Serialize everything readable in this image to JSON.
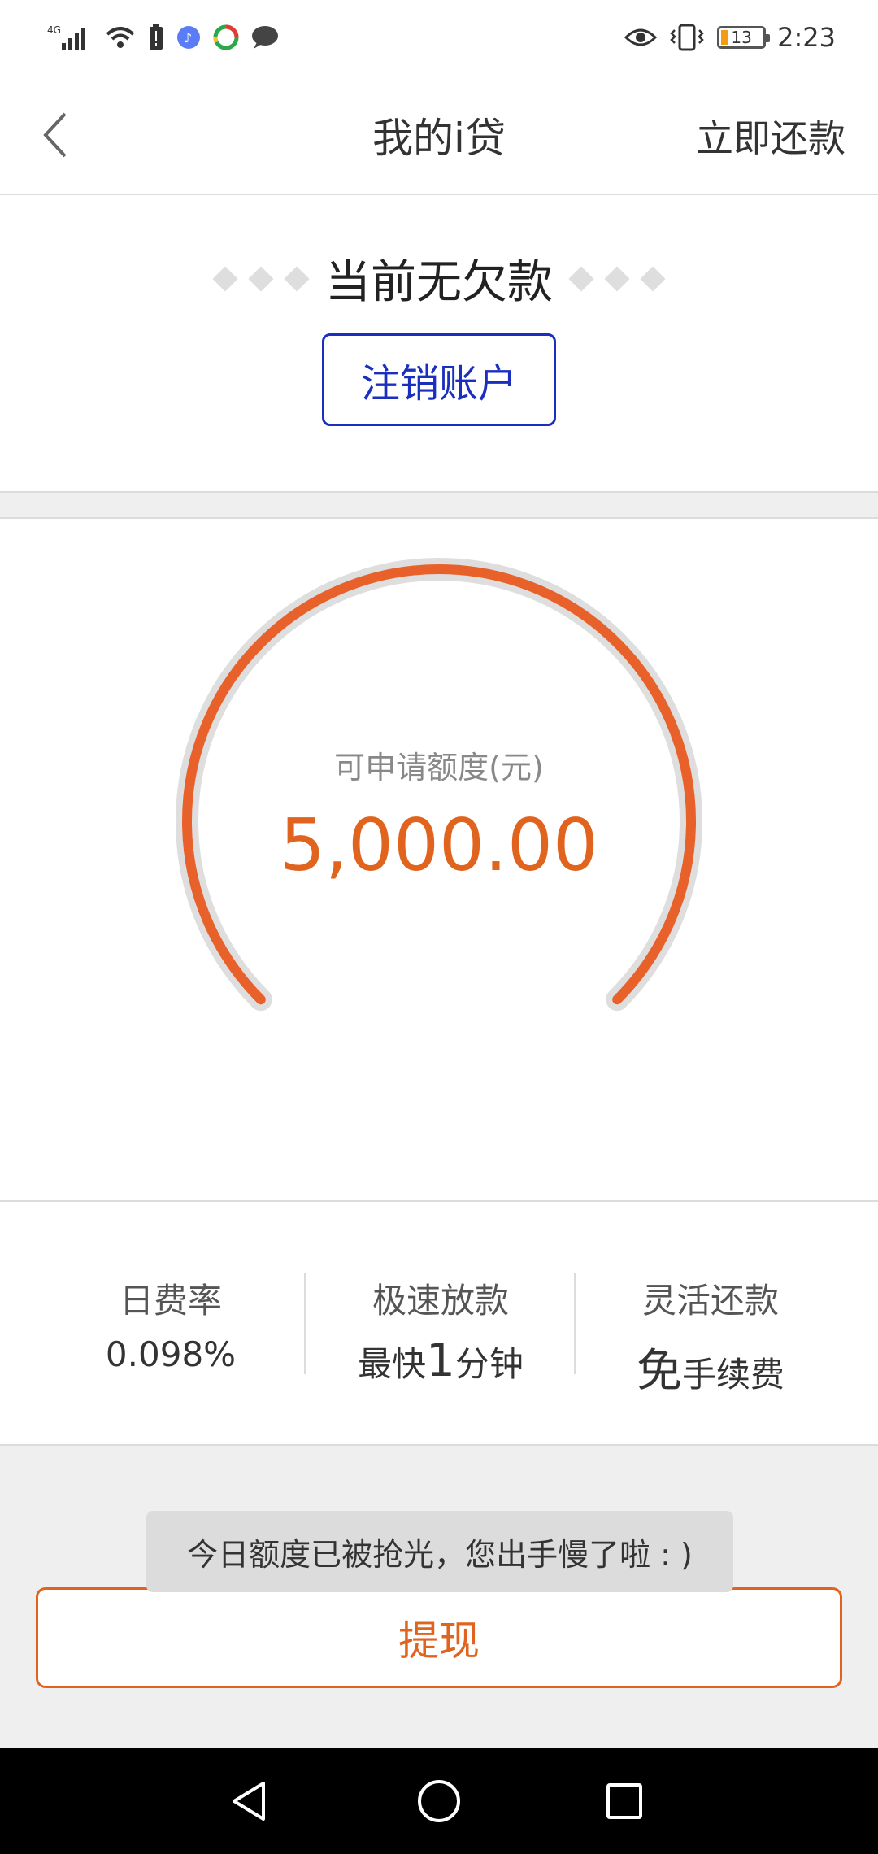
{
  "status_bar": {
    "network": "4G",
    "battery_level": "13",
    "time": "2:23",
    "icons": [
      "signal-icon",
      "wifi-icon",
      "battery-alert-icon",
      "music-app-icon",
      "browser-app-icon",
      "chat-app-icon",
      "eye-icon",
      "vibrate-icon",
      "battery-icon"
    ]
  },
  "navbar": {
    "title": "我的i贷",
    "action_label": "立即还款",
    "back_icon": "chevron-left-icon"
  },
  "debt": {
    "status_text": "当前无欠款",
    "cancel_button_label": "注销账户"
  },
  "gauge": {
    "label": "可申请额度(元)",
    "amount": "5,000.00",
    "arc_color": "#e8602a",
    "track_color": "#dedede"
  },
  "features": [
    {
      "title": "日费率",
      "value": "0.098%"
    },
    {
      "title": "极速放款",
      "value_prefix": "最快",
      "value_emphasis": "1",
      "value_suffix": "分钟"
    },
    {
      "title": "灵活还款",
      "value_emphasis": "免",
      "value_suffix": "手续费"
    }
  ],
  "toast": {
    "message": "今日额度已被抢光，您出手慢了啦 : )"
  },
  "withdraw": {
    "button_label": "提现",
    "accent_color": "#e0641e"
  },
  "system_nav": {
    "icons": [
      "back-triangle-icon",
      "home-circle-icon",
      "recents-square-icon"
    ]
  }
}
